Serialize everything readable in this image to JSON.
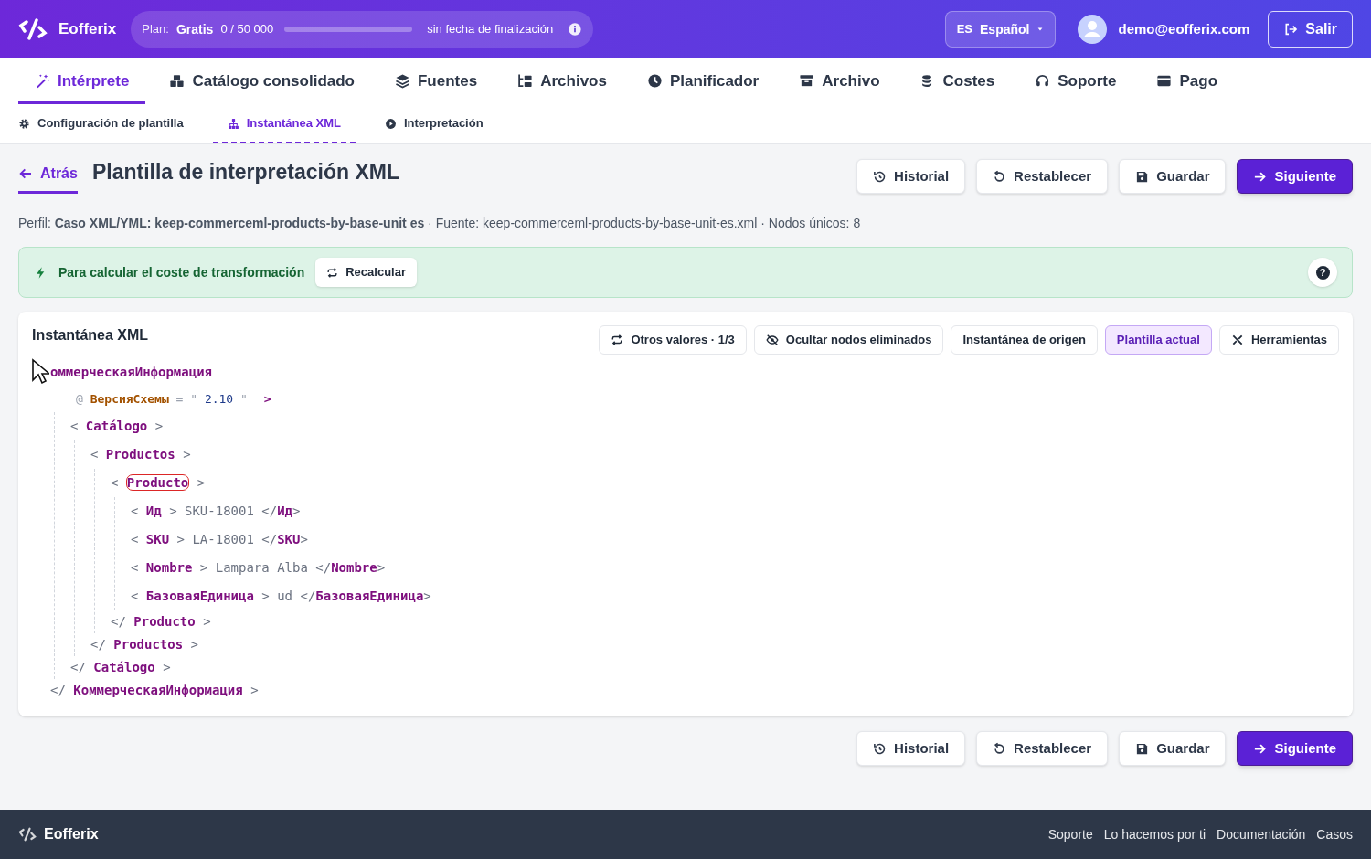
{
  "brand": "Eofferix",
  "plan": {
    "label": "Plan:",
    "name": "Gratis",
    "usage": "0 / 50 000",
    "level": 0,
    "expiry": "sin fecha de finalización"
  },
  "language": {
    "code": "ES",
    "name": "Español"
  },
  "user": {
    "email": "demo@eofferix.com"
  },
  "logout": "Salir",
  "tabs": [
    {
      "label": "Intérprete",
      "selected": true
    },
    {
      "label": "Catálogo consolidado",
      "selected": false
    },
    {
      "label": "Fuentes",
      "selected": false
    },
    {
      "label": "Archivos",
      "selected": false
    },
    {
      "label": "Planificador",
      "selected": false
    },
    {
      "label": "Archivo",
      "selected": false
    },
    {
      "label": "Costes",
      "selected": false
    },
    {
      "label": "Soporte",
      "selected": false
    },
    {
      "label": "Pago",
      "selected": false
    }
  ],
  "subtabs": [
    {
      "label": "Configuración de plantilla",
      "selected": false
    },
    {
      "label": "Instantánea XML",
      "selected": true
    },
    {
      "label": "Interpretación",
      "selected": false
    }
  ],
  "back": "Atrás",
  "title": "Plantilla de interpretación XML",
  "actions": [
    {
      "label": "Historial",
      "kind": "secondary"
    },
    {
      "label": "Restablecer",
      "kind": "secondary"
    },
    {
      "label": "Guardar",
      "kind": "secondary"
    },
    {
      "label": "Siguiente",
      "kind": "primary"
    }
  ],
  "meta": "Perfil: **Caso XML/YML: keep-commerceml-products-by-base-unit es** · Fuente: keep-commerceml-products-by-base-unit-es.xml · Nodos únicos: 8",
  "banner": {
    "text": "Para calcular el coste de transformación",
    "button": "Recalcular",
    "help": "?"
  },
  "snapshot": {
    "title": "Instantánea XML",
    "tools": [
      {
        "label": "Otros valores · 1/3",
        "selected": false
      },
      {
        "label": "Ocultar nodos eliminados",
        "selected": false
      },
      {
        "label": "Instantánea de origen",
        "selected": false
      },
      {
        "label": "Plantilla actual",
        "selected": true
      },
      {
        "label": "Herramientas",
        "selected": false
      }
    ],
    "tree": {
      "open": "**оммерческаяИнформация**",
      "attrs": [
        "@ **ВерсияСхемы** = \" *2.10* \""
      ],
      "open_end": ">",
      "close": "</ **КоммерческаяИнформация** >",
      "children": [
        {
          "open": "< **Catálogo** >",
          "close": "</ **Catálogo** >",
          "children": [
            {
              "open": "< **Productos** >",
              "close": "</ **Productos** >",
              "children": [
                {
                  "open": "< **Producto** >",
                  "close": "</ **Producto** >",
                  "highlighted": true,
                  "children": [
                    {
                      "open": "< **Ид** > SKU-18001 </**Ид**>"
                    },
                    {
                      "open": "< **SKU** > LA-18001 </**SKU**>"
                    },
                    {
                      "open": "< **Nombre** > Lampara Alba </**Nombre**>"
                    },
                    {
                      "open": "< **БазоваяЕдиница** > ud </**БазоваяЕдиница**>"
                    }
                  ]
                }
              ]
            }
          ]
        }
      ]
    }
  },
  "bottom_actions": [
    {
      "label": "Historial",
      "kind": "secondary"
    },
    {
      "label": "Restablecer",
      "kind": "secondary"
    },
    {
      "label": "Guardar",
      "kind": "secondary"
    },
    {
      "label": "Siguiente",
      "kind": "primary"
    }
  ],
  "footer": {
    "brand": "Eofferix",
    "links": [
      "Soporte",
      "Lo hacemos por ti",
      "Documentación",
      "Casos"
    ]
  }
}
